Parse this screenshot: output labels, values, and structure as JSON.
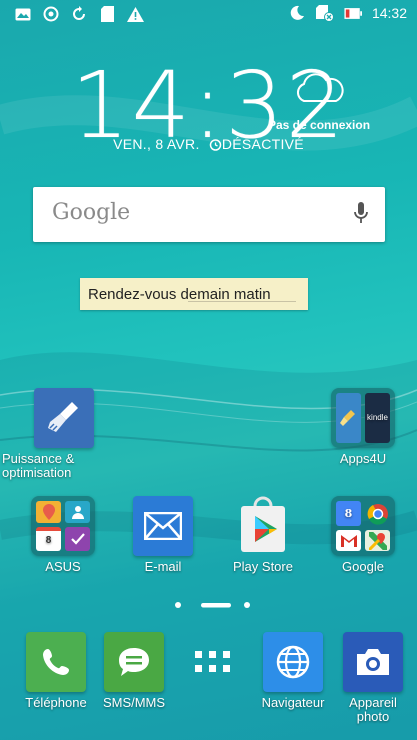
{
  "status_bar": {
    "time": "14:32",
    "left_icons": [
      "image-icon",
      "cast-icon",
      "sync-icon",
      "sd-card-icon",
      "warning-icon"
    ],
    "right_icons": [
      "moon-icon",
      "no-sim-icon",
      "battery-low-icon"
    ]
  },
  "clock": {
    "time": "14:32",
    "date": "VEN., 8 AVR.",
    "alarm": "DÉSACTIVÉ"
  },
  "weather": {
    "status": "Pas de connexion",
    "icon": "cloud-icon"
  },
  "search": {
    "logo": "Google",
    "icon": "microphone-icon"
  },
  "note": {
    "text": "Rendez-vous demain matin"
  },
  "apps_row1": [
    {
      "label": "Puissance & optimisation",
      "label_line1": "Puissance &",
      "label_line2": "optimisation",
      "icon": "broom-cleaner-icon"
    },
    {
      "label": "Apps4U",
      "icon": "apps4u-folder-icon"
    }
  ],
  "apps_row2": [
    {
      "label": "ASUS",
      "icon": "asus-folder-icon"
    },
    {
      "label": "E-mail",
      "icon": "envelope-icon"
    },
    {
      "label": "Play Store",
      "icon": "play-store-icon"
    },
    {
      "label": "Google",
      "icon": "google-folder-icon"
    }
  ],
  "page_indicator": {
    "pages": 3,
    "current": 2
  },
  "dock": [
    {
      "label": "Téléphone",
      "icon": "phone-icon"
    },
    {
      "label": "SMS/MMS",
      "icon": "message-icon"
    },
    {
      "label": "",
      "icon": "app-drawer-icon"
    },
    {
      "label": "Navigateur",
      "icon": "globe-icon"
    },
    {
      "label": "Appareil photo",
      "label_line1": "Appareil",
      "label_line2": "photo",
      "icon": "camera-icon"
    }
  ],
  "colors": {
    "accent_teal": "#1cb2b8",
    "phone_green": "#4caf50",
    "email_blue": "#2b7bd6",
    "browser_blue": "#2d8ee8",
    "camera_blue": "#2a5bb8"
  }
}
